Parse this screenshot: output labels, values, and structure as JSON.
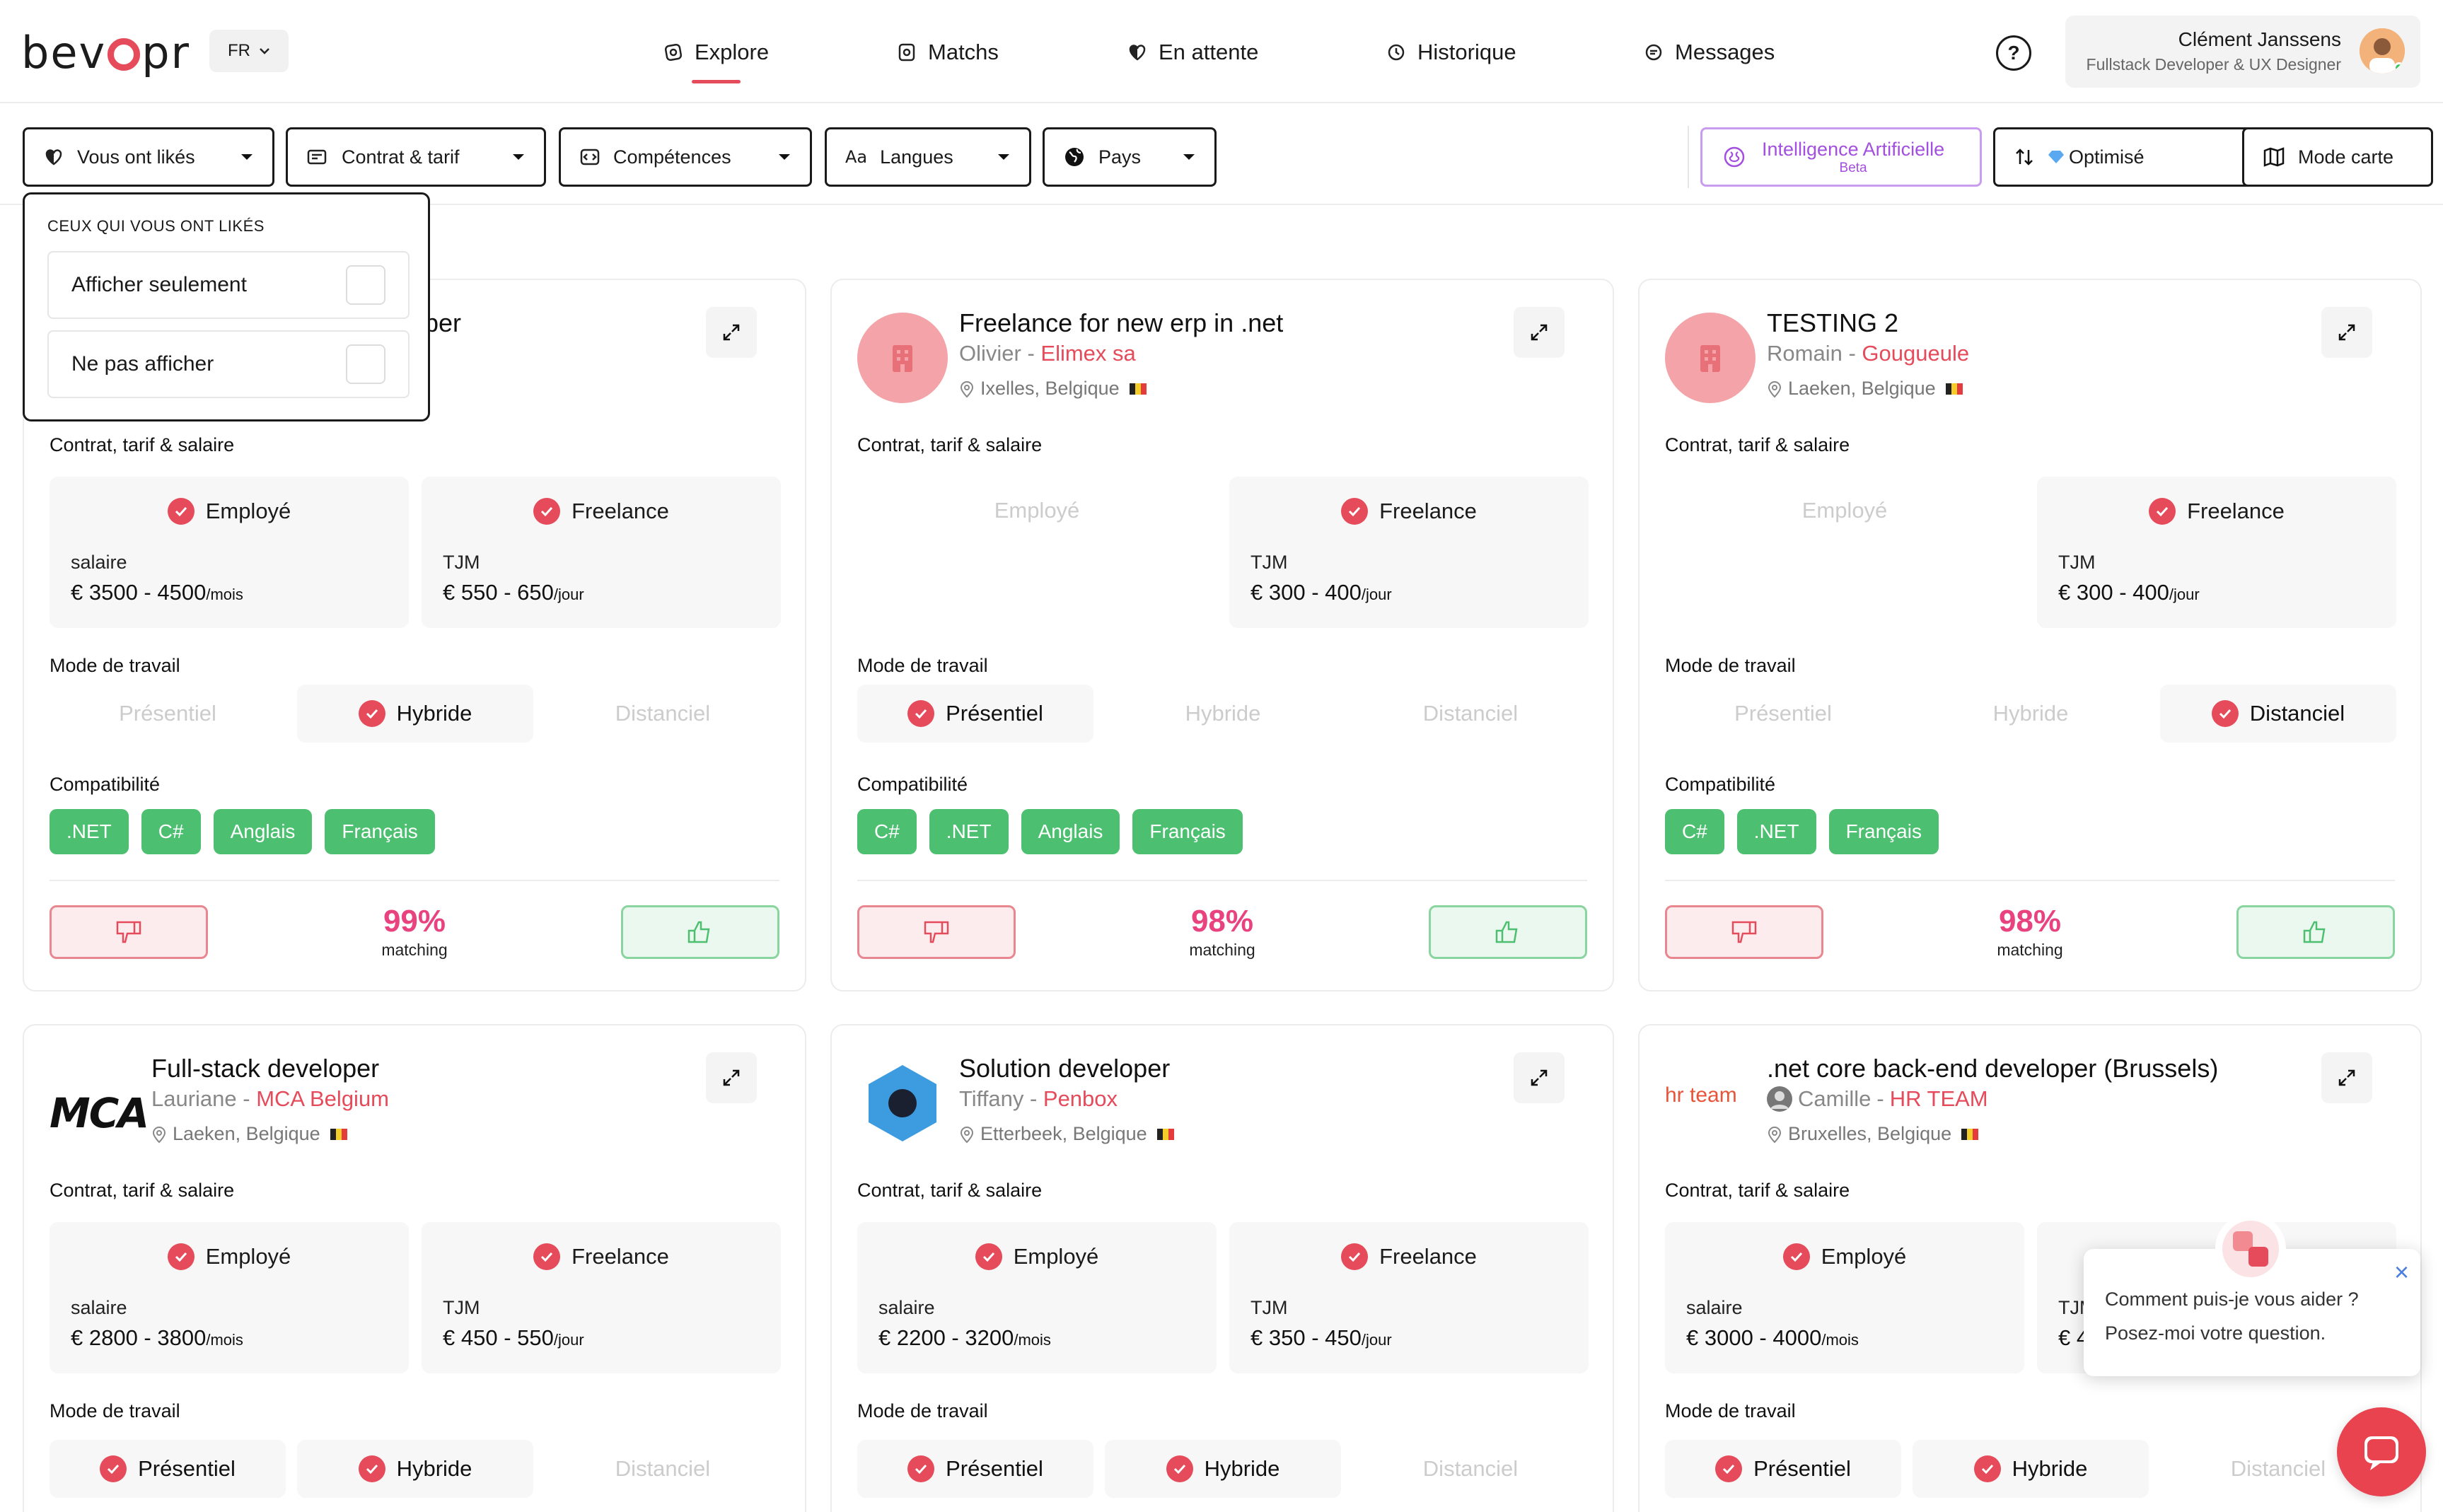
{
  "brand": {
    "logo_pre": "bev",
    "logo_post": "pr"
  },
  "lang": {
    "value": "FR"
  },
  "nav": [
    {
      "label": "Explore",
      "icon": "explore-icon"
    },
    {
      "label": "Matchs",
      "icon": "match-icon"
    },
    {
      "label": "En attente",
      "icon": "heart-half-icon"
    },
    {
      "label": "Historique",
      "icon": "history-icon"
    },
    {
      "label": "Messages",
      "icon": "message-icon"
    }
  ],
  "profile": {
    "name": "Clément Janssens",
    "role": "Fullstack Developer & UX Designer"
  },
  "filters": {
    "liked": "Vous ont likés",
    "contract": "Contrat & tarif",
    "skills": "Compétences",
    "languages": "Langues",
    "country": "Pays",
    "ai_title": "Intelligence Artificielle",
    "ai_beta": "Beta",
    "sort": "Optimisé",
    "map": "Mode carte"
  },
  "dropdown": {
    "header": "CEUX QUI VOUS ONT LIKÉS",
    "opt1": "Afficher seulement",
    "opt2": "Ne pas afficher"
  },
  "labels": {
    "contract_section": "Contrat, tarif & salaire",
    "employee": "Employé",
    "freelance": "Freelance",
    "salary": "salaire",
    "tjm": "TJM",
    "per_month": "/mois",
    "per_day": "/jour",
    "work_mode": "Mode de travail",
    "onsite": "Présentiel",
    "hybrid": "Hybride",
    "remote": "Distanciel",
    "compat": "Compatibilité",
    "matching": "matching"
  },
  "cards": [
    {
      "title": "per",
      "person": "",
      "company": "",
      "location": "",
      "salary": "€ 3500 - 4500",
      "tjm": "€ 550 - 650",
      "tags": [
        ".NET",
        "C#",
        "Anglais",
        "Français"
      ],
      "match": "99%"
    },
    {
      "title": "Freelance for new erp in .net",
      "person": "Olivier",
      "company": "Elimex sa",
      "location": "Ixelles, Belgique",
      "salary": "",
      "tjm": "€ 300 - 400",
      "tags": [
        "C#",
        ".NET",
        "Anglais",
        "Français"
      ],
      "match": "98%"
    },
    {
      "title": "TESTING 2",
      "person": "Romain",
      "company": "Gougueule",
      "location": "Laeken, Belgique",
      "salary": "",
      "tjm": "€ 300 - 400",
      "tags": [
        "C#",
        ".NET",
        "Français"
      ],
      "match": "98%"
    },
    {
      "title": "Full-stack developer",
      "person": "Lauriane",
      "company": "MCA Belgium",
      "location": "Laeken, Belgique",
      "salary": "€ 2800 - 3800",
      "tjm": "€ 450 - 550",
      "logo_text": "MCA"
    },
    {
      "title": "Solution developer",
      "person": "Tiffany",
      "company": "Penbox",
      "location": "Etterbeek, Belgique",
      "salary": "€ 2200 - 3200",
      "tjm": "€ 350 - 450"
    },
    {
      "title": ".net core back-end developer (Brussels)",
      "person": "Camille",
      "company": "HR TEAM",
      "location": "Bruxelles, Belgique",
      "salary": "€ 3000 - 4000",
      "tjm": "€ 4",
      "logo_text": "hr team"
    }
  ],
  "chat": {
    "line1": "Comment puis-je vous aider ?",
    "line2": "Posez-moi votre question.",
    "close": "×"
  },
  "colors": {
    "accent": "#e54b5a",
    "match": "#e8437f",
    "tag": "#4cc070",
    "ai": "#a34fe0"
  }
}
